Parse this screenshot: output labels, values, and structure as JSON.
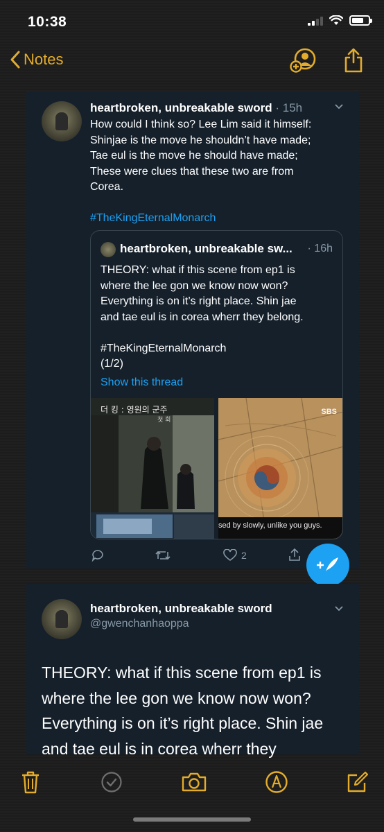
{
  "status_bar": {
    "time": "10:38"
  },
  "nav": {
    "back_label": "Notes"
  },
  "tweet1": {
    "name": "heartbroken, unbreakable sword",
    "time": "· 15h",
    "lines": [
      "How could I think so? Lee Lim said it himself:",
      "Shinjae is the move he shouldn’t have made;",
      "Tae eul is the move he should have made;",
      "These were clues that these two are from",
      "Corea."
    ],
    "hashtag": "#TheKingEternalMonarch",
    "quote": {
      "name": "heartbroken, unbreakable sw...",
      "time": "· 16h",
      "lines": [
        "THEORY: what if this scene from ep1 is",
        "where the lee gon we know now won?",
        "Everything is on it’s right place. Shin jae",
        "and tae eul is in corea wherr they belong."
      ],
      "hashtag": " #TheKingEternalMonarch",
      "part": "(1/2)",
      "show_thread": "Show this thread",
      "media_left_title": "더 킹 : 영원의 군주",
      "media_left_sub": "첫 회",
      "media_right_logo": "SBS",
      "media_right_caption": "sed by slowly, unlike you guys."
    },
    "likes": "2"
  },
  "tweet2": {
    "name": "heartbroken, unbreakable sword",
    "handle": "@gwenchanhaoppa",
    "lines": [
      "THEORY: what if this scene from ep1 is",
      "where the lee gon we know now won?",
      "Everything is on it’s right place. Shin jae",
      "and tae eul is in corea wherr they"
    ]
  },
  "colors": {
    "notes_accent": "#e4ac2b",
    "twitter_bg": "#15202b",
    "twitter_blue": "#1da1f2",
    "twitter_gray": "#8899a6"
  },
  "icons": {
    "nav": [
      "chevron-left-icon",
      "add-person-icon",
      "share-icon"
    ],
    "toolbar": [
      "trash-icon",
      "checklist-icon",
      "camera-icon",
      "markup-icon",
      "compose-icon"
    ]
  }
}
